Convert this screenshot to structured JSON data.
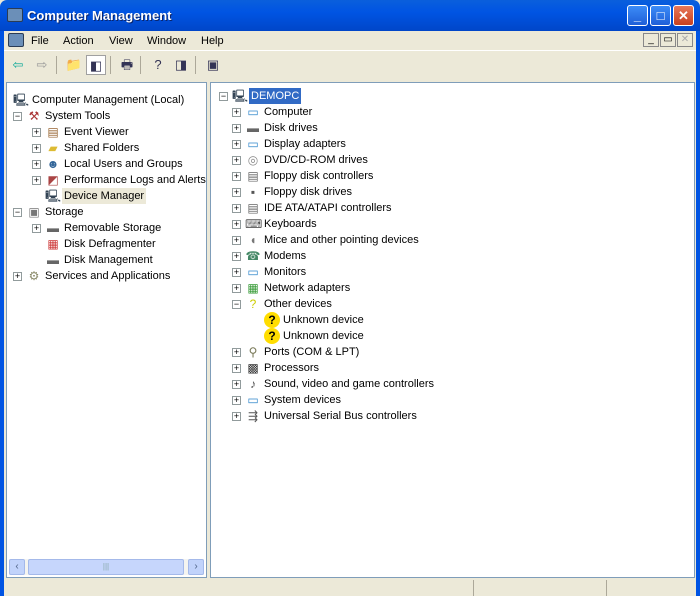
{
  "window": {
    "title": "Computer Management",
    "minimize": "_",
    "maximize": "□",
    "close": "✕"
  },
  "menu": [
    "File",
    "Action",
    "View",
    "Window",
    "Help"
  ],
  "mdi_buttons": [
    "_",
    "▭",
    "✕"
  ],
  "toolbar": [
    {
      "name": "back-icon",
      "g": "⇦"
    },
    {
      "name": "forward-icon",
      "g": "⇨"
    },
    {
      "name": "up-folder-icon",
      "g": "📁"
    },
    {
      "name": "show-hide-tree-icon",
      "g": "◧"
    },
    {
      "name": "print-icon",
      "g": "🖶"
    },
    {
      "name": "help-icon",
      "g": "?"
    },
    {
      "name": "show-hide-action-pane-icon",
      "g": "◨"
    },
    {
      "name": "properties-icon",
      "g": "▣"
    }
  ],
  "left_tree": [
    {
      "label": "Computer Management (Local)",
      "level": 0,
      "exp": "",
      "icon": "computer"
    },
    {
      "label": "System Tools",
      "level": 1,
      "exp": "-",
      "icon": "tools"
    },
    {
      "label": "Event Viewer",
      "level": 2,
      "exp": "+",
      "icon": "event"
    },
    {
      "label": "Shared Folders",
      "level": 2,
      "exp": "+",
      "icon": "folder"
    },
    {
      "label": "Local Users and Groups",
      "level": 2,
      "exp": "+",
      "icon": "users"
    },
    {
      "label": "Performance Logs and Alerts",
      "level": 2,
      "exp": "+",
      "icon": "perf"
    },
    {
      "label": "Device Manager",
      "level": 2,
      "exp": "",
      "icon": "computer",
      "selected": true
    },
    {
      "label": "Storage",
      "level": 1,
      "exp": "-",
      "icon": "storage"
    },
    {
      "label": "Removable Storage",
      "level": 2,
      "exp": "+",
      "icon": "disk"
    },
    {
      "label": "Disk Defragmenter",
      "level": 2,
      "exp": "",
      "icon": "defrag"
    },
    {
      "label": "Disk Management",
      "level": 2,
      "exp": "",
      "icon": "disk"
    },
    {
      "label": "Services and Applications",
      "level": 1,
      "exp": "+",
      "icon": "services"
    }
  ],
  "right_tree": [
    {
      "label": "DEMOPC",
      "level": 0,
      "exp": "-",
      "icon": "computer",
      "selected": true
    },
    {
      "label": "Computer",
      "level": 1,
      "exp": "+",
      "icon": "monitor"
    },
    {
      "label": "Disk drives",
      "level": 1,
      "exp": "+",
      "icon": "disk"
    },
    {
      "label": "Display adapters",
      "level": 1,
      "exp": "+",
      "icon": "monitor"
    },
    {
      "label": "DVD/CD-ROM drives",
      "level": 1,
      "exp": "+",
      "icon": "cd"
    },
    {
      "label": "Floppy disk controllers",
      "level": 1,
      "exp": "+",
      "icon": "controller"
    },
    {
      "label": "Floppy disk drives",
      "level": 1,
      "exp": "+",
      "icon": "floppy"
    },
    {
      "label": "IDE ATA/ATAPI controllers",
      "level": 1,
      "exp": "+",
      "icon": "controller"
    },
    {
      "label": "Keyboards",
      "level": 1,
      "exp": "+",
      "icon": "keyboard"
    },
    {
      "label": "Mice and other pointing devices",
      "level": 1,
      "exp": "+",
      "icon": "mouse"
    },
    {
      "label": "Modems",
      "level": 1,
      "exp": "+",
      "icon": "modem"
    },
    {
      "label": "Monitors",
      "level": 1,
      "exp": "+",
      "icon": "monitor"
    },
    {
      "label": "Network adapters",
      "level": 1,
      "exp": "+",
      "icon": "network"
    },
    {
      "label": "Other devices",
      "level": 1,
      "exp": "-",
      "icon": "unknown"
    },
    {
      "label": "Unknown device",
      "level": 2,
      "exp": "",
      "icon": "warning"
    },
    {
      "label": "Unknown device",
      "level": 2,
      "exp": "",
      "icon": "warning"
    },
    {
      "label": "Ports (COM & LPT)",
      "level": 1,
      "exp": "+",
      "icon": "port"
    },
    {
      "label": "Processors",
      "level": 1,
      "exp": "+",
      "icon": "cpu"
    },
    {
      "label": "Sound, video and game controllers",
      "level": 1,
      "exp": "+",
      "icon": "sound"
    },
    {
      "label": "System devices",
      "level": 1,
      "exp": "+",
      "icon": "monitor"
    },
    {
      "label": "Universal Serial Bus controllers",
      "level": 1,
      "exp": "+",
      "icon": "usb"
    }
  ]
}
